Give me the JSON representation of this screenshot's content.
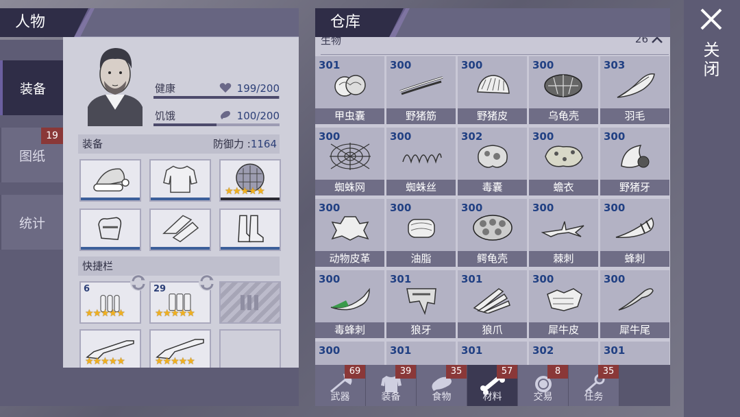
{
  "character": {
    "title": "人物",
    "side_tabs": [
      {
        "label": "装备",
        "active": true
      },
      {
        "label": "图纸",
        "badge": "19"
      },
      {
        "label": "统计"
      }
    ],
    "stats": [
      {
        "label": "健康",
        "value": "199/200",
        "fill": 0.995,
        "icon": "heart-icon"
      },
      {
        "label": "饥饿",
        "value": "100/200",
        "fill": 0.5,
        "icon": "meat-icon"
      }
    ],
    "equipment": {
      "title": "装备",
      "defense_label": "防御力 :",
      "defense_value": "1164",
      "slots": [
        {
          "icon": "santa-hat-icon",
          "stars": ""
        },
        {
          "icon": "shirt-icon",
          "stars": ""
        },
        {
          "icon": "turtle-shell-icon",
          "stars": "★★★★★"
        },
        {
          "icon": "gloves-icon",
          "stars": ""
        },
        {
          "icon": "pants-icon",
          "stars": ""
        },
        {
          "icon": "boots-icon",
          "stars": ""
        }
      ]
    },
    "quickbar": {
      "title": "快捷栏",
      "slots": [
        {
          "icon": "ammo-icon",
          "qty": "6",
          "stars": "★★★★★"
        },
        {
          "icon": "shells-icon",
          "qty": "29",
          "stars": "★★★★★"
        },
        {
          "icon": "locked-slot-icon",
          "qty": "",
          "stars": ""
        },
        {
          "icon": "rifle-icon",
          "qty": "",
          "stars": "★★★★★"
        },
        {
          "icon": "shotgun-icon",
          "qty": "",
          "stars": "★★★★★"
        },
        {
          "icon": "empty-slot",
          "qty": "",
          "stars": ""
        }
      ]
    }
  },
  "storage": {
    "title": "仓库",
    "section_label": "生物",
    "section_count": "26",
    "items": [
      {
        "qty": "301",
        "name": "甲虫囊",
        "icon": "beetle-sac-icon"
      },
      {
        "qty": "300",
        "name": "野猪筋",
        "icon": "boar-tendon-icon"
      },
      {
        "qty": "300",
        "name": "野猪皮",
        "icon": "boar-hide-icon"
      },
      {
        "qty": "300",
        "name": "乌龟壳",
        "icon": "turtle-shell-icon"
      },
      {
        "qty": "303",
        "name": "羽毛",
        "icon": "feather-icon"
      },
      {
        "qty": "300",
        "name": "蜘蛛网",
        "icon": "spider-web-icon"
      },
      {
        "qty": "300",
        "name": "蜘蛛丝",
        "icon": "spider-silk-icon"
      },
      {
        "qty": "302",
        "name": "毒囊",
        "icon": "poison-sac-icon"
      },
      {
        "qty": "300",
        "name": "蟾衣",
        "icon": "toad-skin-icon"
      },
      {
        "qty": "300",
        "name": "野猪牙",
        "icon": "boar-tusk-icon"
      },
      {
        "qty": "300",
        "name": "动物皮革",
        "icon": "animal-leather-icon"
      },
      {
        "qty": "300",
        "name": "油脂",
        "icon": "grease-icon"
      },
      {
        "qty": "300",
        "name": "鳄龟壳",
        "icon": "croc-turtle-shell-icon"
      },
      {
        "qty": "300",
        "name": "棘刺",
        "icon": "thorn-icon"
      },
      {
        "qty": "300",
        "name": "蜂刺",
        "icon": "bee-sting-icon"
      },
      {
        "qty": "300",
        "name": "毒蜂刺",
        "icon": "poison-sting-icon"
      },
      {
        "qty": "301",
        "name": "狼牙",
        "icon": "wolf-fang-icon"
      },
      {
        "qty": "301",
        "name": "狼爪",
        "icon": "wolf-claw-icon"
      },
      {
        "qty": "300",
        "name": "犀牛皮",
        "icon": "rhino-hide-icon"
      },
      {
        "qty": "300",
        "name": "犀牛尾",
        "icon": "rhino-tail-icon"
      },
      {
        "qty": "300",
        "name": "",
        "icon": "partial-item-icon"
      },
      {
        "qty": "301",
        "name": "",
        "icon": "partial-item-icon"
      },
      {
        "qty": "301",
        "name": "",
        "icon": "partial-item-icon"
      },
      {
        "qty": "302",
        "name": "",
        "icon": "partial-item-icon"
      },
      {
        "qty": "301",
        "name": "",
        "icon": "partial-item-icon"
      }
    ],
    "bottom_tabs": [
      {
        "label": "武器",
        "badge": "69",
        "icon": "axe-icon"
      },
      {
        "label": "装备",
        "badge": "39",
        "icon": "shirt-icon"
      },
      {
        "label": "食物",
        "badge": "35",
        "icon": "meat-icon"
      },
      {
        "label": "材料",
        "badge": "57",
        "icon": "bone-icon",
        "active": true
      },
      {
        "label": "交易",
        "badge": "8",
        "icon": "coin-icon"
      },
      {
        "label": "任务",
        "badge": "35",
        "icon": "key-icon"
      }
    ]
  },
  "close": {
    "label": "关闭"
  },
  "colors": {
    "header_dark": "#2f2d47",
    "qty_blue": "#214083",
    "badge_red": "#8a3838",
    "star_gold": "#f0b020"
  }
}
